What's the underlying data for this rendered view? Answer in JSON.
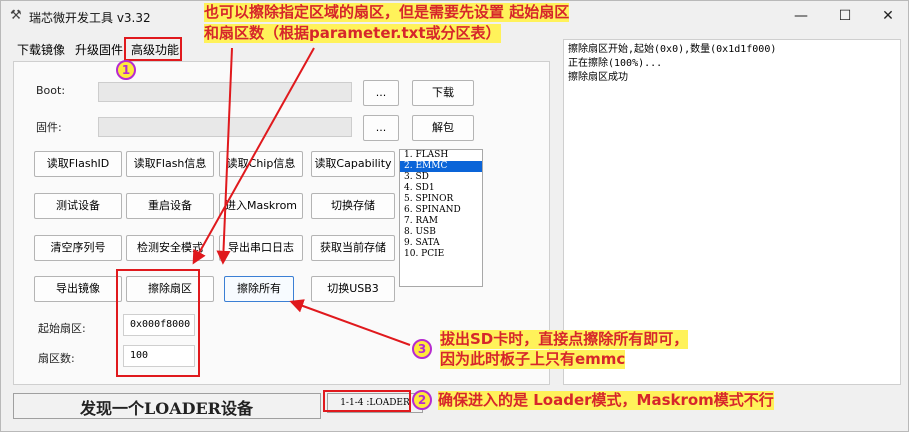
{
  "window": {
    "title": "瑞芯微开发工具 v3.32",
    "app_icon": "tools-icon",
    "minimize_glyph": "—",
    "maximize_glyph": "☐",
    "close_glyph": "✕"
  },
  "tabs": [
    {
      "label": "下载镜像"
    },
    {
      "label": "升级固件"
    },
    {
      "label": "高级功能"
    }
  ],
  "fields": {
    "boot_label": "Boot:",
    "boot_value": "",
    "boot_browse": "...",
    "boot_action": "下载",
    "firmware_label": "固件:",
    "firmware_value": "",
    "firmware_browse": "...",
    "firmware_action": "解包"
  },
  "buttons": {
    "read_flash_id": "读取FlashID",
    "read_flash_info": "读取Flash信息",
    "read_chip_info": "读取Chip信息",
    "read_capability": "读取Capability",
    "test_device": "测试设备",
    "reboot_device": "重启设备",
    "enter_maskrom": "进入Maskrom",
    "switch_storage": "切换存储",
    "clear_serial": "清空序列号",
    "detect_safe_mode": "检测安全模式",
    "export_serial_log": "导出串口日志",
    "get_current_storage": "获取当前存储",
    "export_image": "导出镜像",
    "erase_sector": "擦除扇区",
    "erase_all": "擦除所有",
    "switch_usb3": "切换USB3"
  },
  "sector": {
    "start_label": "起始扇区:",
    "start_value": "0x000f8000",
    "count_label": "扇区数:",
    "count_value": "100"
  },
  "storage_list": [
    {
      "label": "1. FLASH",
      "selected": false
    },
    {
      "label": "2. EMMC",
      "selected": true
    },
    {
      "label": "3. SD",
      "selected": false
    },
    {
      "label": "4. SD1",
      "selected": false
    },
    {
      "label": "5. SPINOR",
      "selected": false
    },
    {
      "label": "6. SPINAND",
      "selected": false
    },
    {
      "label": "7. RAM",
      "selected": false
    },
    {
      "label": "8. USB",
      "selected": false
    },
    {
      "label": "9. SATA",
      "selected": false
    },
    {
      "label": "10. PCIE",
      "selected": false
    }
  ],
  "log": [
    "擦除扇区开始,起始(0x0),数量(0x1d1f000)",
    "正在擦除(100%)...",
    "擦除扇区成功"
  ],
  "status": {
    "message": "发现一个LOADER设备",
    "device_path": "1-1-4 :LOADER"
  },
  "annotations": {
    "top_line1": "也可以擦除指定区域的扇区，但是需要先设置 起始扇区",
    "top_line2": "和扇区数（根据parameter.txt或分区表）",
    "mid_line1": "拔出SD卡时，直接点擦除所有即可，",
    "mid_line2": "因为此时板子上只有emmc",
    "bottom_line": "确保进入的是 Loader模式，Maskrom模式不行",
    "badge1": "1",
    "badge2": "2",
    "badge3": "3",
    "color_red": "#e0191d",
    "color_badge": "#ffe93b"
  }
}
